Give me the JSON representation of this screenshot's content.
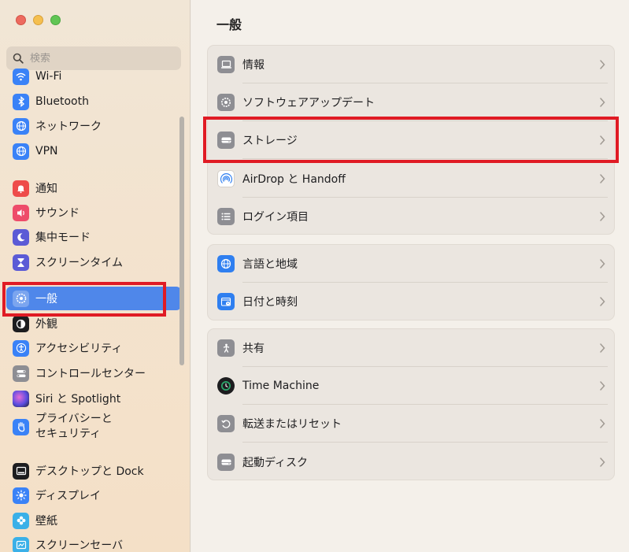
{
  "window": {
    "traffic_lights": [
      "close",
      "minimize",
      "zoom"
    ]
  },
  "search": {
    "placeholder": "検索"
  },
  "sidebar": {
    "items": [
      {
        "label": "Wi-Fi",
        "icon": "wifi-icon",
        "color": "#3a82f7"
      },
      {
        "label": "Bluetooth",
        "icon": "bluetooth-icon",
        "color": "#3a82f7"
      },
      {
        "label": "ネットワーク",
        "icon": "globe-icon",
        "color": "#3a82f7"
      },
      {
        "label": "VPN",
        "icon": "globe-icon",
        "color": "#3a82f7"
      },
      {
        "label": "通知",
        "icon": "bell-icon",
        "color": "#ee4c4a"
      },
      {
        "label": "サウンド",
        "icon": "speaker-icon",
        "color": "#ee4c6a"
      },
      {
        "label": "集中モード",
        "icon": "moon-icon",
        "color": "#5b5bd6"
      },
      {
        "label": "スクリーンタイム",
        "icon": "hourglass-icon",
        "color": "#5b5bd6"
      },
      {
        "label": "一般",
        "icon": "gear-icon",
        "color": "#8e8e93",
        "selected": true
      },
      {
        "label": "外観",
        "icon": "appearance-icon",
        "color": "#1d1d1f"
      },
      {
        "label": "アクセシビリティ",
        "icon": "accessibility-icon",
        "color": "#3a82f7"
      },
      {
        "label": "コントロールセンター",
        "icon": "toggles-icon",
        "color": "#8e8e93"
      },
      {
        "label": "Siri と Spotlight",
        "icon": "siri-icon",
        "color": "#2b2b3a"
      },
      {
        "label": "プライバシーと\nセキュリティ",
        "icon": "hand-icon",
        "color": "#3a82f7"
      },
      {
        "label": "デスクトップと Dock",
        "icon": "dock-icon",
        "color": "#1d1d1f"
      },
      {
        "label": "ディスプレイ",
        "icon": "sun-icon",
        "color": "#3a82f7"
      },
      {
        "label": "壁紙",
        "icon": "flower-icon",
        "color": "#3ab0e8"
      },
      {
        "label": "スクリーンセーバ",
        "icon": "screensaver-icon",
        "color": "#3ab0e8"
      }
    ]
  },
  "main": {
    "title": "一般",
    "groups": [
      {
        "rows": [
          {
            "label": "情報",
            "icon": "laptop-icon"
          },
          {
            "label": "ソフトウェアアップデート",
            "icon": "gear-badge-icon"
          },
          {
            "label": "ストレージ",
            "icon": "drive-icon"
          },
          {
            "label": "AirDrop と Handoff",
            "icon": "airdrop-icon"
          },
          {
            "label": "ログイン項目",
            "icon": "list-icon"
          }
        ]
      },
      {
        "rows": [
          {
            "label": "言語と地域",
            "icon": "globe-icon"
          },
          {
            "label": "日付と時刻",
            "icon": "calendar-clock-icon"
          }
        ]
      },
      {
        "rows": [
          {
            "label": "共有",
            "icon": "sharing-icon"
          },
          {
            "label": "Time Machine",
            "icon": "time-machine-icon"
          },
          {
            "label": "転送またはリセット",
            "icon": "reset-icon"
          },
          {
            "label": "起動ディスク",
            "icon": "startup-disk-icon"
          }
        ]
      }
    ]
  },
  "highlights": {
    "color": "#e01b24",
    "targets": [
      "sidebar-item-general",
      "row-storage"
    ]
  }
}
